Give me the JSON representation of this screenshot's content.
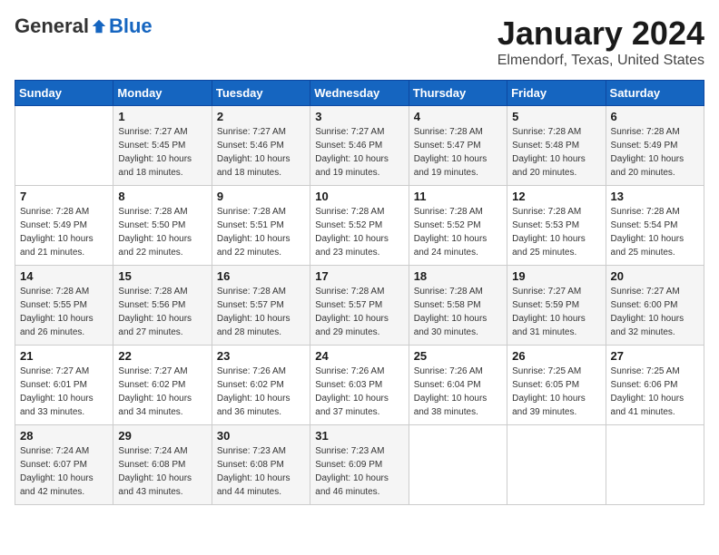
{
  "header": {
    "logo_general": "General",
    "logo_blue": "Blue",
    "calendar_title": "January 2024",
    "calendar_subtitle": "Elmendorf, Texas, United States"
  },
  "weekdays": [
    "Sunday",
    "Monday",
    "Tuesday",
    "Wednesday",
    "Thursday",
    "Friday",
    "Saturday"
  ],
  "weeks": [
    [
      {
        "day": "",
        "sunrise": "",
        "sunset": "",
        "daylight": ""
      },
      {
        "day": "1",
        "sunrise": "Sunrise: 7:27 AM",
        "sunset": "Sunset: 5:45 PM",
        "daylight": "Daylight: 10 hours and 18 minutes."
      },
      {
        "day": "2",
        "sunrise": "Sunrise: 7:27 AM",
        "sunset": "Sunset: 5:46 PM",
        "daylight": "Daylight: 10 hours and 18 minutes."
      },
      {
        "day": "3",
        "sunrise": "Sunrise: 7:27 AM",
        "sunset": "Sunset: 5:46 PM",
        "daylight": "Daylight: 10 hours and 19 minutes."
      },
      {
        "day": "4",
        "sunrise": "Sunrise: 7:28 AM",
        "sunset": "Sunset: 5:47 PM",
        "daylight": "Daylight: 10 hours and 19 minutes."
      },
      {
        "day": "5",
        "sunrise": "Sunrise: 7:28 AM",
        "sunset": "Sunset: 5:48 PM",
        "daylight": "Daylight: 10 hours and 20 minutes."
      },
      {
        "day": "6",
        "sunrise": "Sunrise: 7:28 AM",
        "sunset": "Sunset: 5:49 PM",
        "daylight": "Daylight: 10 hours and 20 minutes."
      }
    ],
    [
      {
        "day": "7",
        "sunrise": "Sunrise: 7:28 AM",
        "sunset": "Sunset: 5:49 PM",
        "daylight": "Daylight: 10 hours and 21 minutes."
      },
      {
        "day": "8",
        "sunrise": "Sunrise: 7:28 AM",
        "sunset": "Sunset: 5:50 PM",
        "daylight": "Daylight: 10 hours and 22 minutes."
      },
      {
        "day": "9",
        "sunrise": "Sunrise: 7:28 AM",
        "sunset": "Sunset: 5:51 PM",
        "daylight": "Daylight: 10 hours and 22 minutes."
      },
      {
        "day": "10",
        "sunrise": "Sunrise: 7:28 AM",
        "sunset": "Sunset: 5:52 PM",
        "daylight": "Daylight: 10 hours and 23 minutes."
      },
      {
        "day": "11",
        "sunrise": "Sunrise: 7:28 AM",
        "sunset": "Sunset: 5:52 PM",
        "daylight": "Daylight: 10 hours and 24 minutes."
      },
      {
        "day": "12",
        "sunrise": "Sunrise: 7:28 AM",
        "sunset": "Sunset: 5:53 PM",
        "daylight": "Daylight: 10 hours and 25 minutes."
      },
      {
        "day": "13",
        "sunrise": "Sunrise: 7:28 AM",
        "sunset": "Sunset: 5:54 PM",
        "daylight": "Daylight: 10 hours and 25 minutes."
      }
    ],
    [
      {
        "day": "14",
        "sunrise": "Sunrise: 7:28 AM",
        "sunset": "Sunset: 5:55 PM",
        "daylight": "Daylight: 10 hours and 26 minutes."
      },
      {
        "day": "15",
        "sunrise": "Sunrise: 7:28 AM",
        "sunset": "Sunset: 5:56 PM",
        "daylight": "Daylight: 10 hours and 27 minutes."
      },
      {
        "day": "16",
        "sunrise": "Sunrise: 7:28 AM",
        "sunset": "Sunset: 5:57 PM",
        "daylight": "Daylight: 10 hours and 28 minutes."
      },
      {
        "day": "17",
        "sunrise": "Sunrise: 7:28 AM",
        "sunset": "Sunset: 5:57 PM",
        "daylight": "Daylight: 10 hours and 29 minutes."
      },
      {
        "day": "18",
        "sunrise": "Sunrise: 7:28 AM",
        "sunset": "Sunset: 5:58 PM",
        "daylight": "Daylight: 10 hours and 30 minutes."
      },
      {
        "day": "19",
        "sunrise": "Sunrise: 7:27 AM",
        "sunset": "Sunset: 5:59 PM",
        "daylight": "Daylight: 10 hours and 31 minutes."
      },
      {
        "day": "20",
        "sunrise": "Sunrise: 7:27 AM",
        "sunset": "Sunset: 6:00 PM",
        "daylight": "Daylight: 10 hours and 32 minutes."
      }
    ],
    [
      {
        "day": "21",
        "sunrise": "Sunrise: 7:27 AM",
        "sunset": "Sunset: 6:01 PM",
        "daylight": "Daylight: 10 hours and 33 minutes."
      },
      {
        "day": "22",
        "sunrise": "Sunrise: 7:27 AM",
        "sunset": "Sunset: 6:02 PM",
        "daylight": "Daylight: 10 hours and 34 minutes."
      },
      {
        "day": "23",
        "sunrise": "Sunrise: 7:26 AM",
        "sunset": "Sunset: 6:02 PM",
        "daylight": "Daylight: 10 hours and 36 minutes."
      },
      {
        "day": "24",
        "sunrise": "Sunrise: 7:26 AM",
        "sunset": "Sunset: 6:03 PM",
        "daylight": "Daylight: 10 hours and 37 minutes."
      },
      {
        "day": "25",
        "sunrise": "Sunrise: 7:26 AM",
        "sunset": "Sunset: 6:04 PM",
        "daylight": "Daylight: 10 hours and 38 minutes."
      },
      {
        "day": "26",
        "sunrise": "Sunrise: 7:25 AM",
        "sunset": "Sunset: 6:05 PM",
        "daylight": "Daylight: 10 hours and 39 minutes."
      },
      {
        "day": "27",
        "sunrise": "Sunrise: 7:25 AM",
        "sunset": "Sunset: 6:06 PM",
        "daylight": "Daylight: 10 hours and 41 minutes."
      }
    ],
    [
      {
        "day": "28",
        "sunrise": "Sunrise: 7:24 AM",
        "sunset": "Sunset: 6:07 PM",
        "daylight": "Daylight: 10 hours and 42 minutes."
      },
      {
        "day": "29",
        "sunrise": "Sunrise: 7:24 AM",
        "sunset": "Sunset: 6:08 PM",
        "daylight": "Daylight: 10 hours and 43 minutes."
      },
      {
        "day": "30",
        "sunrise": "Sunrise: 7:23 AM",
        "sunset": "Sunset: 6:08 PM",
        "daylight": "Daylight: 10 hours and 44 minutes."
      },
      {
        "day": "31",
        "sunrise": "Sunrise: 7:23 AM",
        "sunset": "Sunset: 6:09 PM",
        "daylight": "Daylight: 10 hours and 46 minutes."
      },
      {
        "day": "",
        "sunrise": "",
        "sunset": "",
        "daylight": ""
      },
      {
        "day": "",
        "sunrise": "",
        "sunset": "",
        "daylight": ""
      },
      {
        "day": "",
        "sunrise": "",
        "sunset": "",
        "daylight": ""
      }
    ]
  ]
}
